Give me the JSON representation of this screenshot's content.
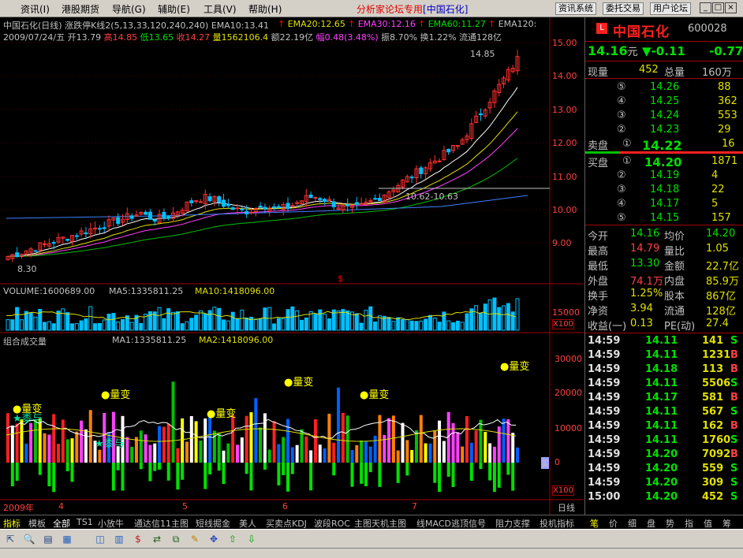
{
  "menu": {
    "items": [
      "资讯(I)",
      "港股期货",
      "导航(G)",
      "辅助(E)",
      "工具(V)",
      "帮助(H)"
    ],
    "forum_label": "分析家论坛专用",
    "stock_label": "[中国石化]",
    "buttons": [
      "资讯系统",
      "委托交易",
      "用户论坛"
    ],
    "win_buttons": [
      "_",
      "□",
      "×"
    ]
  },
  "chart": {
    "title_line1": "中国石化(日线) 涨跌停K线2(5,13,33,120,240,240) EMA10:13.41",
    "ema20": "EMA20:12.65",
    "ema30": "EMA30:12.16",
    "ema60": "EMA60:11.27",
    "ema120": "EMA120:",
    "info_date": "2009/07/24/五",
    "info_open": "开13.79",
    "info_high": "高14.85",
    "info_low": "低13.65",
    "info_close": "收14.27",
    "info_vol": "量1562106.4",
    "info_amount": "额22.19亿",
    "info_range": "幅0.48(3.48%)",
    "info_amp": "振8.70%",
    "info_turn": "换1.22%",
    "info_float": "流通128亿",
    "price_axis": [
      "15.00",
      "14.00",
      "13.00",
      "12.00",
      "11.00",
      "10.00",
      "9.00"
    ],
    "high_marker": "14.85",
    "low_marker": "8.30",
    "range_label": "10.62-10.63",
    "s_marker": "$",
    "volume_title": "VOLUME:1600689.00",
    "ma5": "MA5:1335811.25",
    "ma10": "MA10:1418096.00",
    "vol_axis": "15000",
    "vol_mult": "X100",
    "combo_title": "组合成交量",
    "ma1": "MA1:1335811.25",
    "ma2": "MA2:1418096.00",
    "combo_axis": [
      "30000",
      "20000",
      "10000",
      "0"
    ],
    "combo_mult": "X100",
    "annotations": {
      "liangbian": "量变",
      "qianyu": "黍与"
    },
    "buy_label": "买",
    "date_axis": [
      "2009年",
      "4",
      "5",
      "6",
      "7"
    ],
    "period": "日线"
  },
  "quote": {
    "name": "中国石化",
    "code": "600028",
    "logo": "L",
    "price": "14.16",
    "unit": "元",
    "change": "▼-0.11",
    "change2": "-0.77",
    "xianliang_label": "现量",
    "xianliang": "452",
    "zongliang_label": "总量",
    "zongliang": "160万",
    "sell": [
      {
        "lvl": "⑤",
        "price": "14.26",
        "vol": "88"
      },
      {
        "lvl": "④",
        "price": "14.25",
        "vol": "362"
      },
      {
        "lvl": "③",
        "price": "14.24",
        "vol": "553"
      },
      {
        "lvl": "②",
        "price": "14.23",
        "vol": "29"
      },
      {
        "lvl": "①",
        "price": "14.22",
        "vol": "16"
      }
    ],
    "sell_label": "卖盘",
    "buy_label": "买盘",
    "buy": [
      {
        "lvl": "①",
        "price": "14.20",
        "vol": "1871"
      },
      {
        "lvl": "②",
        "price": "14.19",
        "vol": "4"
      },
      {
        "lvl": "③",
        "price": "14.18",
        "vol": "22"
      },
      {
        "lvl": "④",
        "price": "14.17",
        "vol": "5"
      },
      {
        "lvl": "⑤",
        "price": "14.15",
        "vol": "157"
      }
    ],
    "stats": [
      [
        "今开",
        "14.16",
        "均价",
        "14.20"
      ],
      [
        "最高",
        "14.79",
        "量比",
        "1.05"
      ],
      [
        "最低",
        "13.30",
        "金额",
        "22.7亿"
      ],
      [
        "外盘",
        "74.1万",
        "内盘",
        "85.9万"
      ],
      [
        "换手",
        "1.25%",
        "股本",
        "867亿"
      ],
      [
        "净资",
        "3.94",
        "流通",
        "128亿"
      ],
      [
        "收益(一)",
        "0.13",
        "PE(动)",
        "27.4"
      ]
    ],
    "ticks": [
      [
        "14:59",
        "14.11",
        "141",
        "S"
      ],
      [
        "14:59",
        "14.11",
        "1231",
        "B"
      ],
      [
        "14:59",
        "14.18",
        "113",
        "B"
      ],
      [
        "14:59",
        "14.11",
        "5506",
        "S"
      ],
      [
        "14:59",
        "14.17",
        "581",
        "B"
      ],
      [
        "14:59",
        "14.11",
        "567",
        "S"
      ],
      [
        "14:59",
        "14.11",
        "162",
        "B"
      ],
      [
        "14:59",
        "14.11",
        "1760",
        "S"
      ],
      [
        "14:59",
        "14.20",
        "7092",
        "B"
      ],
      [
        "14:59",
        "14.20",
        "559",
        "S"
      ],
      [
        "14:59",
        "14.20",
        "309",
        "S"
      ],
      [
        "15:00",
        "14.20",
        "452",
        "S"
      ]
    ]
  },
  "tabs": [
    "指标",
    "模板",
    "全部",
    "TS1",
    "小放牛",
    "通达信11主图",
    "短线掘金",
    "美人",
    "买卖点KDJ",
    "波段ROC",
    "主图天机主图",
    "线MACD",
    "逃顶信号",
    "阻力支撑",
    "投机指标"
  ],
  "right_tabs": [
    "笔",
    "价",
    "细",
    "盘",
    "势",
    "指",
    "值",
    "筹"
  ],
  "toolbar_icons": [
    "cursor-icon",
    "zoom-icon",
    "list-icon",
    "chart-icon",
    "indicator-icon",
    "bars-icon",
    "money-icon",
    "link-icon",
    "copy-icon",
    "pencil-icon",
    "move-icon",
    "up-arrow-icon",
    "down-arrow-icon"
  ]
}
